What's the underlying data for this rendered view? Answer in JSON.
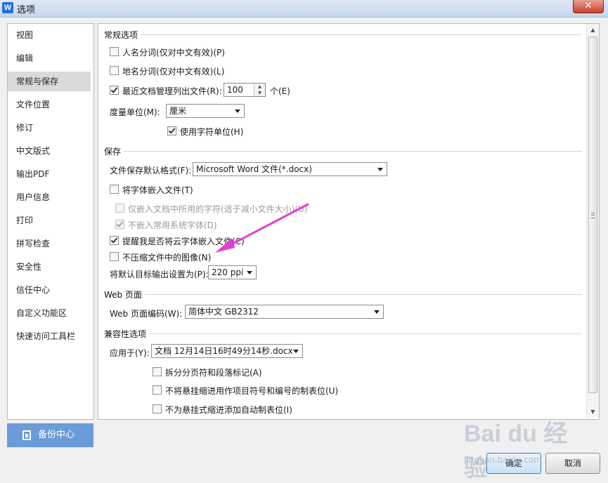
{
  "window": {
    "title": "选项",
    "app_icon": "W",
    "close_glyph": "✕"
  },
  "sidebar": {
    "items": [
      {
        "label": "视图"
      },
      {
        "label": "编辑"
      },
      {
        "label": "常规与保存",
        "active": true
      },
      {
        "label": "文件位置"
      },
      {
        "label": "修订"
      },
      {
        "label": "中文版式"
      },
      {
        "label": "输出PDF"
      },
      {
        "label": "用户信息"
      },
      {
        "label": "打印"
      },
      {
        "label": "拼写检查"
      },
      {
        "label": "安全性"
      },
      {
        "label": "信任中心"
      },
      {
        "label": "自定义功能区"
      },
      {
        "label": "快速访问工具栏"
      }
    ],
    "backup_label": "备份中心"
  },
  "general": {
    "title": "常规选项",
    "person_name": {
      "label": "人名分词(仅对中文有效)(P)",
      "checked": false
    },
    "place_name": {
      "label": "地名分词(仅对中文有效)(L)",
      "checked": false
    },
    "recent_files": {
      "label": "最近文档管理列出文件(R):",
      "checked": true,
      "value": "100",
      "unit": "个(E)"
    },
    "measure_unit": {
      "label": "度量单位(M):",
      "value": "厘米"
    },
    "char_unit": {
      "label": "使用字符单位(H)",
      "checked": true
    }
  },
  "save": {
    "title": "保存",
    "default_format": {
      "label": "文件保存默认格式(F):",
      "value": "Microsoft Word 文件(*.docx)"
    },
    "embed_fonts": {
      "label": "将字体嵌入文件(T)",
      "checked": false
    },
    "embed_used_only": {
      "label": "仅嵌入文档中所用的字符(适于减小文件大小)(U)",
      "checked": false,
      "disabled": true
    },
    "no_common_fonts": {
      "label": "不嵌入常用系统字体(D)",
      "checked": true,
      "disabled": true
    },
    "remind_cloud_fonts": {
      "label": "提醒我是否将云字体嵌入文件(C)",
      "checked": true
    },
    "no_compress_images": {
      "label": "不压缩文件中的图像(N)",
      "checked": false
    },
    "default_output": {
      "label": "将默认目标输出设置为(P):",
      "value": "220 ppi"
    }
  },
  "web": {
    "title": "Web 页面",
    "encoding": {
      "label": "Web 页面编码(W):",
      "value": "简体中文 GB2312"
    }
  },
  "compat": {
    "title": "兼容性选项",
    "apply_to": {
      "label": "应用于(Y):",
      "value": "文档 12月14日16时49分14秒.docx"
    },
    "split_page_break": {
      "label": "拆分分页符和段落标记(A)",
      "checked": false
    },
    "no_hanging_indent": {
      "label": "不将悬挂缩进用作项目符号和编号的制表位(U)",
      "checked": false
    },
    "no_auto_tab": {
      "label": "不为悬挂式缩进添加自动制表位(I)",
      "checked": false
    }
  },
  "buttons": {
    "ok": "确定",
    "cancel": "取消"
  },
  "annotation": {
    "color": "#e23fd6"
  },
  "watermark": {
    "text": "Bai du 经验",
    "sub": "jingyan.baidu.com"
  }
}
